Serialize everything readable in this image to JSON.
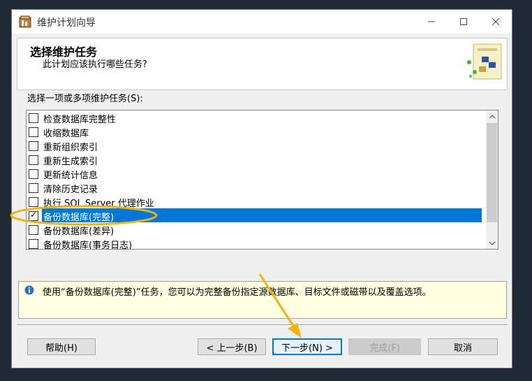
{
  "window": {
    "title": "维护计划向导"
  },
  "header": {
    "title": "选择维护任务",
    "subtitle": "此计划应该执行哪些任务?"
  },
  "list": {
    "label": "选择一项或多项维护任务(S):",
    "items": [
      {
        "label": "检查数据库完整性",
        "checked": false,
        "selected": false
      },
      {
        "label": "收缩数据库",
        "checked": false,
        "selected": false
      },
      {
        "label": "重新组织索引",
        "checked": false,
        "selected": false
      },
      {
        "label": "重新生成索引",
        "checked": false,
        "selected": false
      },
      {
        "label": "更新统计信息",
        "checked": false,
        "selected": false
      },
      {
        "label": "清除历史记录",
        "checked": false,
        "selected": false
      },
      {
        "label": "执行 SQL Server 代理作业",
        "checked": false,
        "selected": false
      },
      {
        "label": "备份数据库(完整)",
        "checked": true,
        "selected": true
      },
      {
        "label": "备份数据库(差异)",
        "checked": false,
        "selected": false
      },
      {
        "label": "备份数据库(事务日志)",
        "checked": false,
        "selected": false
      }
    ]
  },
  "description": "使用“备份数据库(完整)”任务，您可以为完整备份指定源数据库、目标文件或磁带以及覆盖选项。",
  "buttons": {
    "help": "帮助(H)",
    "back": "< 上一步(B)",
    "next": "下一步(N) >",
    "finish": "完成(F)",
    "cancel": "取消"
  },
  "icons": {
    "app": "maintenance-plan-icon",
    "info": "info-icon",
    "wizard": "wizard-graphic-icon"
  },
  "colors": {
    "selection": "#0078d7",
    "annotation": "#f5b30a",
    "description_bg": "#ffffe1"
  }
}
